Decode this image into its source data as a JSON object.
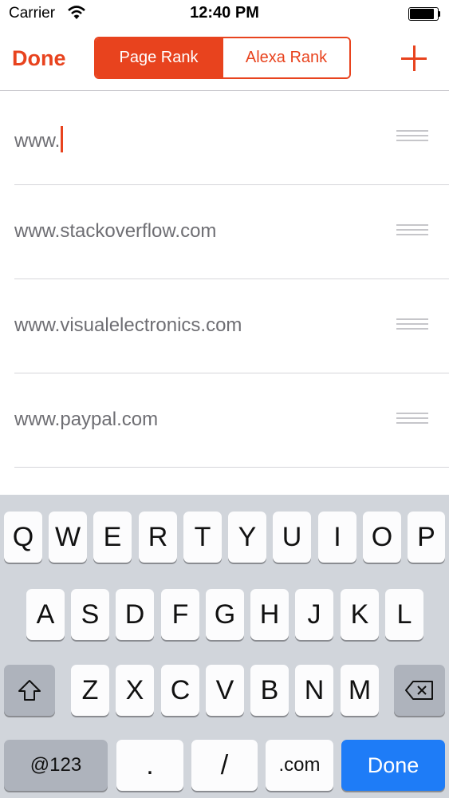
{
  "status_bar": {
    "carrier": "Carrier",
    "time": "12:40 PM",
    "battery_level": 0.95
  },
  "nav": {
    "done_label": "Done",
    "segments": [
      {
        "label": "Page Rank",
        "selected": true
      },
      {
        "label": "Alexa Rank",
        "selected": false
      }
    ],
    "add_icon": "plus-icon"
  },
  "list": {
    "items": [
      {
        "text": "www.",
        "editing": true
      },
      {
        "text": "www.stackoverflow.com"
      },
      {
        "text": "www.visualelectronics.com"
      },
      {
        "text": "www.paypal.com"
      }
    ]
  },
  "keyboard": {
    "row1": [
      "Q",
      "W",
      "E",
      "R",
      "T",
      "Y",
      "U",
      "I",
      "O",
      "P"
    ],
    "row2": [
      "A",
      "S",
      "D",
      "F",
      "G",
      "H",
      "J",
      "K",
      "L"
    ],
    "row3": [
      "Z",
      "X",
      "C",
      "V",
      "B",
      "N",
      "M"
    ],
    "shift_icon": "shift-icon",
    "delete_icon": "delete-icon",
    "numbers_label": "@123",
    "period_label": ".",
    "slash_label": "/",
    "dotcom_label": ".com",
    "done_label": "Done"
  },
  "colors": {
    "accent": "#e8431e",
    "done_key": "#1e7cf7"
  }
}
